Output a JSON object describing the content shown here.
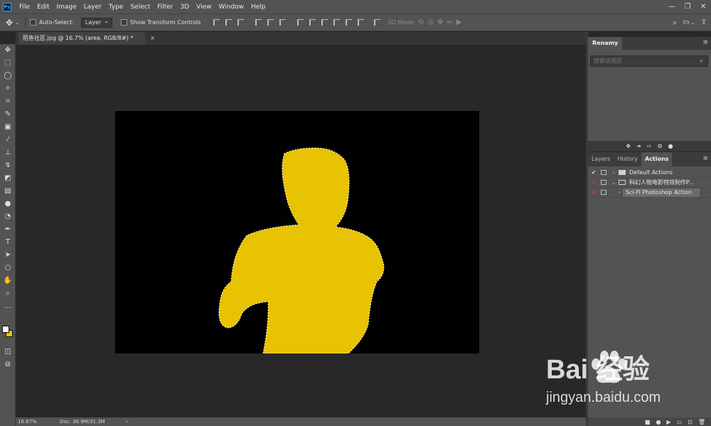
{
  "app": {
    "logo_text": "Ps"
  },
  "menu": [
    "File",
    "Edit",
    "Image",
    "Layer",
    "Type",
    "Select",
    "Filter",
    "3D",
    "View",
    "Window",
    "Help"
  ],
  "window_controls": {
    "minimize": "—",
    "restore": "❐",
    "close": "✕"
  },
  "options_bar": {
    "auto_select_label": "Auto-Select:",
    "auto_select_value": "Layer",
    "show_transform_label": "Show Transform Controls",
    "mode_label": "3D Mode:"
  },
  "document": {
    "tab_title": "陌鱼社区.jpg @ 16.7% (area, RGB/8#) *",
    "close": "×"
  },
  "status": {
    "zoom": "16.67%",
    "doc_size": "Doc: 36.9M/31.3M",
    "arrow": "›"
  },
  "renamy_panel": {
    "title": "Renamy",
    "search_placeholder": "搜索该图层"
  },
  "actions_panel": {
    "tabs": [
      "Layers",
      "History",
      "Actions"
    ],
    "active_tab": "Actions",
    "rows": [
      {
        "check": "✔",
        "label": "Default Actions",
        "expanded": false,
        "folder": true,
        "check_color": "#d8d8d8"
      },
      {
        "check": "✔",
        "label": "科幻人物电影特效制作P...",
        "expanded": true,
        "folder": true,
        "check_color": "#e23b3b"
      },
      {
        "check": "✔",
        "label": "Sci-Fi Photoshop Action",
        "expanded": false,
        "folder": false,
        "check_color": "#e23b3b"
      }
    ]
  },
  "colors": {
    "foreground": "#ffffff",
    "background": "#e8c301",
    "selection_fill": "#e8c301"
  },
  "watermark": {
    "line1": "Bai  经验",
    "line2": "jingyan.baidu.com"
  }
}
